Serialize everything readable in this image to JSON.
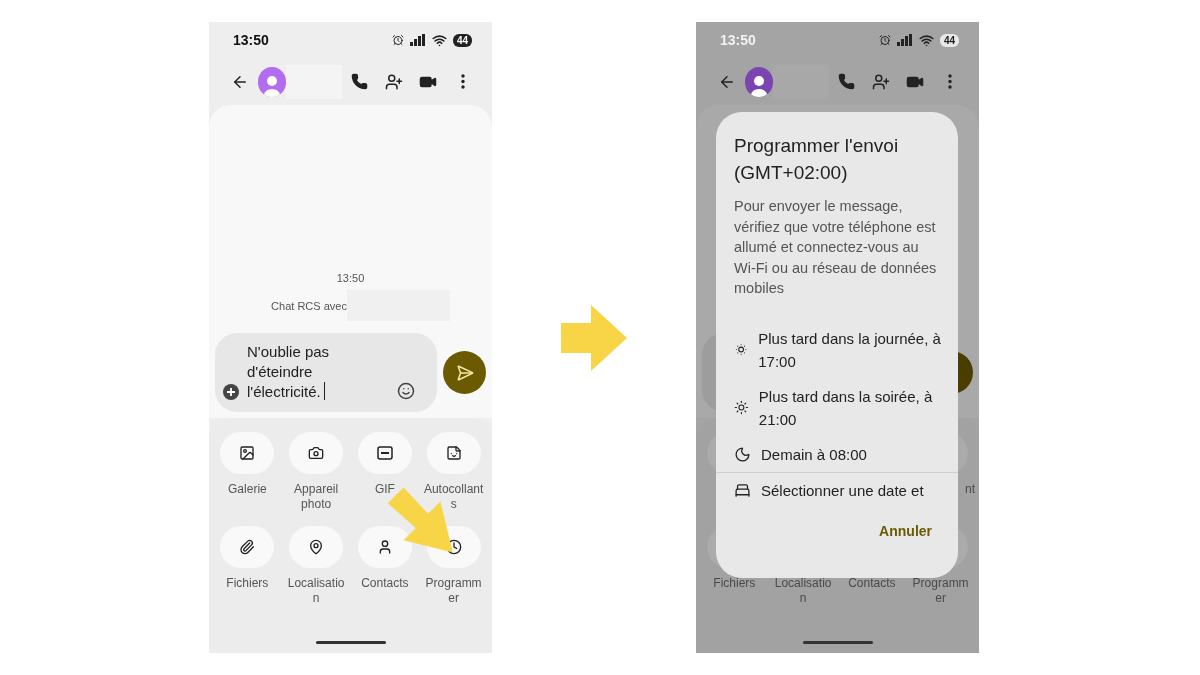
{
  "left_phone": {
    "status": {
      "time": "13:50",
      "battery": "44"
    },
    "conversation": {
      "timestamp": "13:50",
      "rcs_notice": "Chat RCS avec"
    },
    "composer": {
      "value": "N'oublie pas d'éteindre l'électricité."
    },
    "attachments": [
      {
        "kind": "gallery",
        "label": "Galerie"
      },
      {
        "kind": "camera",
        "label": "Appareil photo"
      },
      {
        "kind": "gif",
        "label": "GIF"
      },
      {
        "kind": "sticker",
        "label": "Autocollants"
      },
      {
        "kind": "files",
        "label": "Fichiers"
      },
      {
        "kind": "location",
        "label": "Localisation"
      },
      {
        "kind": "contacts",
        "label": "Contacts"
      },
      {
        "kind": "schedule",
        "label": "Programmer"
      }
    ]
  },
  "right_phone": {
    "status": {
      "time": "13:50",
      "battery": "44"
    },
    "sticker_label_fragment": "nt",
    "bottom_labels": [
      "Fichiers",
      "Localisation",
      "Contacts",
      "Programmer"
    ],
    "dialog": {
      "title": "Programmer l'envoi (GMT+02:00)",
      "message": "Pour envoyer le message, vérifiez que votre téléphone est allumé et connectez-vous au Wi-Fi ou au réseau de données mobiles",
      "options": [
        {
          "kind": "afternoon",
          "label": "Plus tard dans la journée, à 17:00"
        },
        {
          "kind": "evening",
          "label": "Plus tard dans la soirée, à 21:00"
        },
        {
          "kind": "morning",
          "label": "Demain à 08:00"
        },
        {
          "kind": "custom",
          "label": "Sélectionner une date et"
        }
      ],
      "cancel": "Annuler"
    }
  }
}
